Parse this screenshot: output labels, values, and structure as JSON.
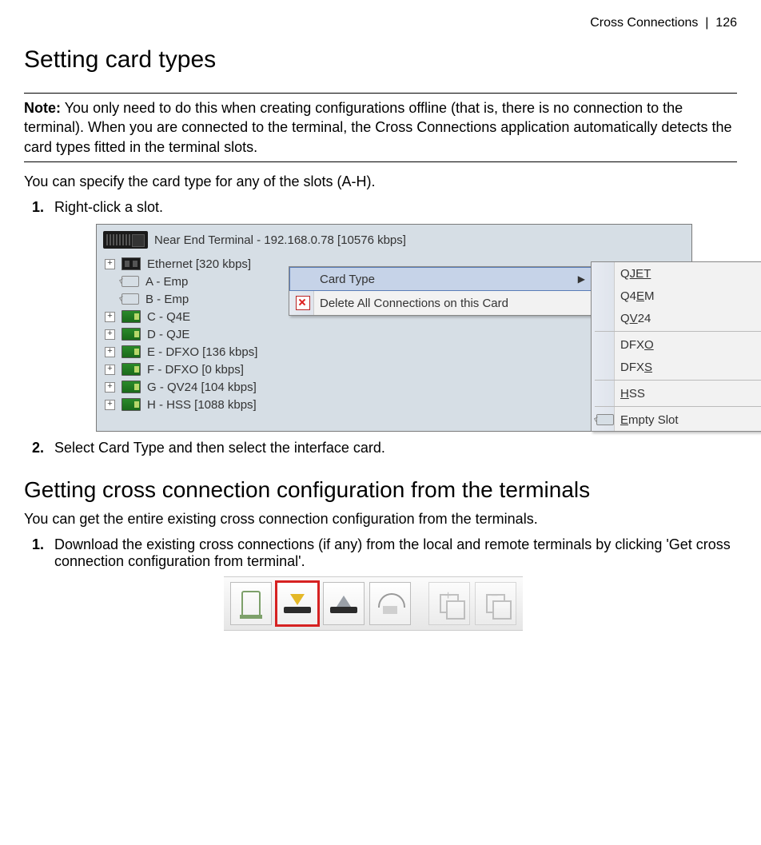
{
  "header": {
    "section": "Cross Connections",
    "sep": "|",
    "page": "126"
  },
  "h1": "Setting card types",
  "note": {
    "label": "Note:",
    "text": "You only need to do this when creating configurations offline (that is, there is no connection to the terminal). When you are connected to the terminal, the Cross Connections application automatically detects the card types fitted in the terminal slots."
  },
  "p1": "You can specify the card type for any of the slots (A-H).",
  "steps1": {
    "s1": "Right-click a slot.",
    "s2": "Select Card Type and then select the interface card."
  },
  "appshot": {
    "title": "Near End Terminal - 192.168.0.78 [10576 kbps]",
    "rows": {
      "eth": "Ethernet [320 kbps]",
      "a": "A - Emp",
      "b": "B - Emp",
      "c": "C - Q4E",
      "d": "D - QJE",
      "e": "E - DFXO [136 kbps]",
      "f": "F - DFXO [0 kbps]",
      "g": "G - QV24 [104 kbps]",
      "h": "H - HSS [1088 kbps]"
    },
    "ctx": {
      "item1": "Card Type",
      "item2": "Delete All Connections on this Card"
    },
    "sub": {
      "i1a": "Q",
      "i1b": "JET",
      "i2a": "Q4",
      "i2b": "E",
      "i2c": "M",
      "i3a": "Q",
      "i3b": "V",
      "i3c": "24",
      "i4a": "DFX",
      "i4b": "O",
      "i5a": "DFX",
      "i5b": "S",
      "i6a": "H",
      "i6b": "SS",
      "i7a": "E",
      "i7b": "mpty Slot"
    }
  },
  "h2": "Getting cross connection configuration from the terminals",
  "p2": "You can get the entire existing cross connection configuration from the terminals.",
  "steps2": {
    "s1": "Download the existing cross connections (if any) from the local and remote terminals by clicking 'Get cross connection configuration from terminal'."
  }
}
